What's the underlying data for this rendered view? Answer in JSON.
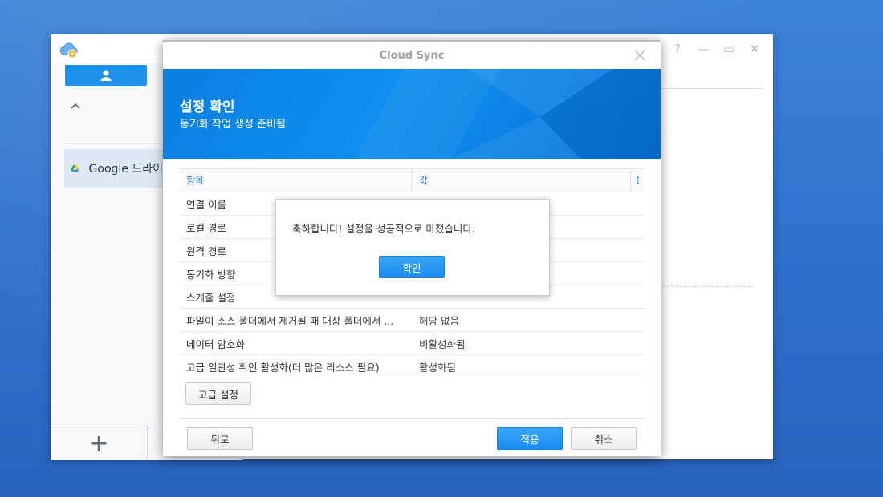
{
  "colors": {
    "accent": "#1e90ee",
    "banner_start": "#0a7fe0",
    "banner_end": "#0572d6",
    "header_link": "#2f7fc9"
  },
  "app": {
    "window_controls": [
      "help-icon",
      "minimize-icon",
      "maximize-icon",
      "close-icon"
    ],
    "sidebar": {
      "active_tab_icon": "user-icon",
      "collapse_icon": "chevron-up-icon",
      "items": [
        {
          "label": "Google 드라이",
          "icon": "google-drive-icon"
        }
      ]
    },
    "add_button": "+"
  },
  "dialog": {
    "title": "Cloud Sync",
    "banner": {
      "title": "설정 확인",
      "subtitle": "동기화 작업 생성 준비됨"
    },
    "grid": {
      "columns": [
        "항목",
        "값"
      ],
      "menu_icon": "⋮",
      "rows": [
        {
          "item": "연결 이름",
          "value": ""
        },
        {
          "item": "로컬 경로",
          "value": ""
        },
        {
          "item": "원격 경로",
          "value": ""
        },
        {
          "item": "동기화 방향",
          "value": ""
        },
        {
          "item": "스케줄 설정",
          "value": ""
        },
        {
          "item": "파일이 소스 폴더에서 제거될 때 대상 폴더에서 ...",
          "value": "해당 없음"
        },
        {
          "item": "데이터 암호화",
          "value": "비활성화됨"
        },
        {
          "item": "고급 일관성 확인 활성화(더 많은 리소스 필요)",
          "value": "활성화됨"
        }
      ]
    },
    "advanced_button": "고급 설정",
    "back_button": "뒤로",
    "apply_button": "적용",
    "cancel_button": "취소"
  },
  "message_box": {
    "text": "축하합니다! 설정을 성공적으로 마쳤습니다.",
    "ok_button": "확인"
  }
}
